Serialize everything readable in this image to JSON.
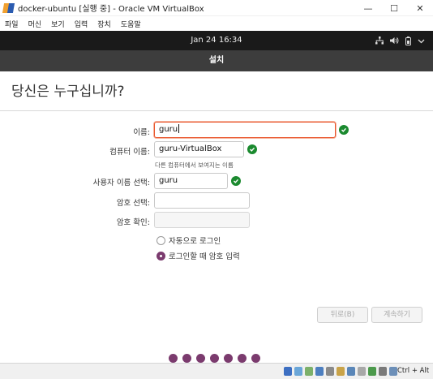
{
  "window": {
    "title": "docker-ubuntu [실행 중] - Oracle VM VirtualBox",
    "minimize": "—",
    "maximize": "☐",
    "close": "✕"
  },
  "menu": [
    "파일",
    "머신",
    "보기",
    "입력",
    "장치",
    "도움말"
  ],
  "gnome": {
    "clock": "Jan 24  16:34"
  },
  "installer": {
    "header": "설치",
    "question": "당신은 누구십니까?",
    "name_label": "이름:",
    "name_value": "guru",
    "computer_label": "컴퓨터 이름:",
    "computer_value": "guru-VirtualBox",
    "computer_hint": "다른 컴퓨터에서 보여지는 이름",
    "username_label": "사용자 이름 선택:",
    "username_value": "guru",
    "password_label": "암호 선택:",
    "password_value": "",
    "confirm_label": "암호 확인:",
    "confirm_value": "",
    "auto_login": "자동으로 로그인",
    "require_password": "로그인할 때 암호 입력",
    "selected_login_option": "require_password",
    "back_button": "뒤로(B)",
    "continue_button": "계속하기",
    "progress_step_count": 7
  },
  "statusbar": {
    "host_key": "Ctrl + Alt"
  },
  "colors": {
    "accent": "#7b3b6e",
    "focus": "#e9542b",
    "valid": "#1b8a2f"
  }
}
